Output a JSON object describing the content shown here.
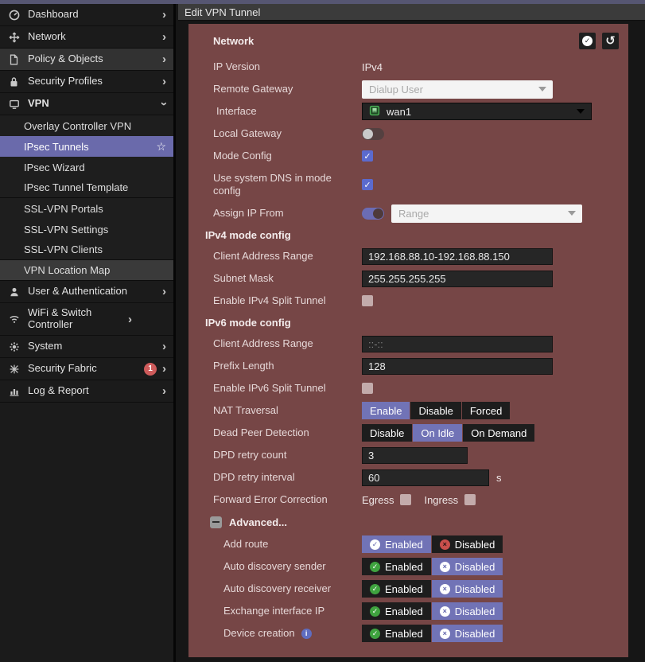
{
  "title": "Edit VPN Tunnel",
  "sidebar": {
    "items": [
      {
        "label": "Dashboard"
      },
      {
        "label": "Network"
      },
      {
        "label": "Policy & Objects"
      },
      {
        "label": "Security Profiles"
      },
      {
        "label": "VPN"
      }
    ],
    "vpn_submenu": {
      "group1": [
        "Overlay Controller VPN",
        "IPsec Tunnels",
        "IPsec Wizard",
        "IPsec Tunnel Template"
      ],
      "group2": [
        "SSL-VPN Portals",
        "SSL-VPN Settings",
        "SSL-VPN Clients"
      ],
      "group3": [
        "VPN Location Map"
      ]
    },
    "bottom_items": [
      {
        "label": "User & Authentication"
      },
      {
        "label": "WiFi & Switch Controller"
      },
      {
        "label": "System"
      },
      {
        "label": "Security Fabric",
        "badge": "1"
      },
      {
        "label": "Log & Report"
      }
    ]
  },
  "panel": {
    "section_network": "Network",
    "ip_version": {
      "label": "IP Version",
      "value": "IPv4"
    },
    "remote_gateway": {
      "label": "Remote Gateway",
      "value": "Dialup User"
    },
    "interface": {
      "label": "Interface",
      "value": "wan1"
    },
    "local_gateway": {
      "label": "Local Gateway",
      "state": "off"
    },
    "mode_config": {
      "label": "Mode Config",
      "checked": true
    },
    "dns_mode": {
      "label": "Use system DNS in mode config",
      "checked": true
    },
    "assign_ip_from": {
      "label": "Assign IP From",
      "state": "on",
      "value": "Range"
    },
    "section_ipv4": "IPv4 mode config",
    "v4_client_range": {
      "label": "Client Address Range",
      "value": "192.168.88.10-192.168.88.150"
    },
    "subnet_mask": {
      "label": "Subnet Mask",
      "value": "255.255.255.255"
    },
    "v4_split": {
      "label": "Enable IPv4 Split Tunnel",
      "checked": false
    },
    "section_ipv6": "IPv6 mode config",
    "v6_client_range": {
      "label": "Client Address Range",
      "placeholder": "::-::"
    },
    "prefix_length": {
      "label": "Prefix Length",
      "value": "128"
    },
    "v6_split": {
      "label": "Enable IPv6 Split Tunnel",
      "checked": false
    },
    "nat_traversal": {
      "label": "NAT Traversal",
      "options": [
        "Enable",
        "Disable",
        "Forced"
      ],
      "selected": "Enable"
    },
    "dead_peer_detection": {
      "label": "Dead Peer Detection",
      "options": [
        "Disable",
        "On Idle",
        "On Demand"
      ],
      "selected": "On Idle"
    },
    "dpd_retry_count": {
      "label": "DPD retry count",
      "value": "3"
    },
    "dpd_retry_interval": {
      "label": "DPD retry interval",
      "value": "60",
      "suffix": "s"
    },
    "fec": {
      "label": "Forward Error Correction",
      "egress": "Egress",
      "ingress": "Ingress"
    },
    "advanced_label": "Advanced...",
    "toggle_labels": {
      "enabled": "Enabled",
      "disabled": "Disabled"
    },
    "add_route": {
      "label": "Add route",
      "selected": "Enabled"
    },
    "auto_discovery_sender": {
      "label": "Auto discovery sender",
      "selected": "Disabled"
    },
    "auto_discovery_receiver": {
      "label": "Auto discovery receiver",
      "selected": "Disabled"
    },
    "exchange_interface_ip": {
      "label": "Exchange interface IP",
      "selected": "Disabled"
    },
    "device_creation": {
      "label": "Device creation",
      "selected": "Disabled"
    }
  },
  "colors": {
    "top_strip": "#565672",
    "panel_background": "#764646",
    "accent_purple": "#7173b6",
    "sidebar_selected": "#6a6aab",
    "checkbox_checked": "#5b6ace",
    "enabled_green": "#3fa33f",
    "disabled_red": "#c94f4c",
    "badge_red": "#ce5b5b",
    "interface_icon_green": "#4db457"
  }
}
